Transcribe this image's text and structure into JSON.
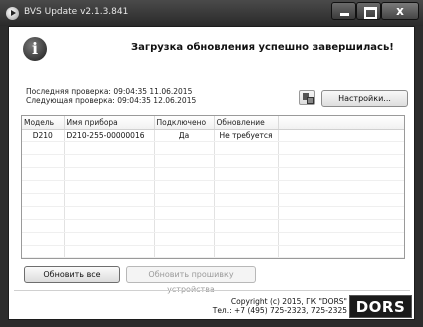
{
  "window": {
    "title": "BVS Update v2.1.3.841",
    "close_symbol": "x"
  },
  "status": {
    "message": "Загрузка обновления успешно завершилась!",
    "icon": "info-icon"
  },
  "checks": {
    "last": "Последняя проверка: 09:04:35 11.06.2015",
    "next": "Следующая проверка: 09:04:35 12.06.2015"
  },
  "toolbar": {
    "settings_label": "Настройки..."
  },
  "table": {
    "columns": [
      "Модель",
      "Имя прибора",
      "Подключено",
      "Обновление"
    ],
    "rows": [
      [
        "D210",
        "D210-255-00000016",
        "Да",
        "Не требуется"
      ]
    ]
  },
  "buttons": {
    "update_all": "Обновить все",
    "update_firmware": "Обновить прошивку устройства"
  },
  "footer": {
    "copyright": "Copyright (c) 2015, ГК \"DORS\"",
    "phone": "Тел.: +7 (495) 725-2323, 725-2325",
    "logo": "DORS"
  }
}
